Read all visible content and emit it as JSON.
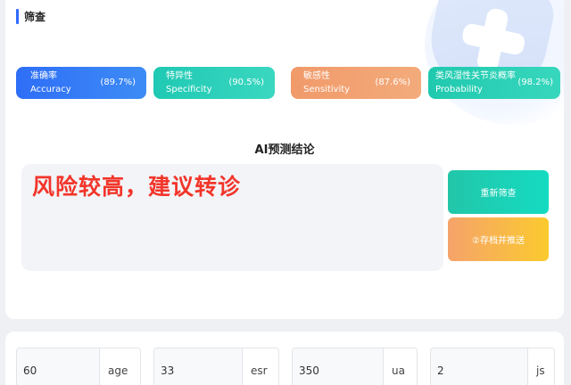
{
  "section": {
    "title": "筛查"
  },
  "metrics": [
    {
      "cn": "准确率",
      "en": "Accuracy",
      "pct": "(89.7%)"
    },
    {
      "cn": "特异性",
      "en": "Specificity",
      "pct": "(90.5%)"
    },
    {
      "cn": "敏感性",
      "en": "Sensitivity",
      "pct": "(87.6%)"
    },
    {
      "cn": "类风湿性关节炎概率",
      "en": "Probability",
      "pct": "(98.2%)"
    }
  ],
  "ai": {
    "title": "AI预测结论",
    "result": "风险较高，建议转诊"
  },
  "buttons": {
    "rescreen": "重新筛查",
    "save": "②存档并推送"
  },
  "fields": [
    {
      "value": "60",
      "unit": "age"
    },
    {
      "value": "33",
      "unit": "esr"
    },
    {
      "value": "350",
      "unit": "ua"
    },
    {
      "value": "2",
      "unit": "js"
    }
  ],
  "colors": {
    "accent": "#2f6bff",
    "result": "#f2352a"
  }
}
